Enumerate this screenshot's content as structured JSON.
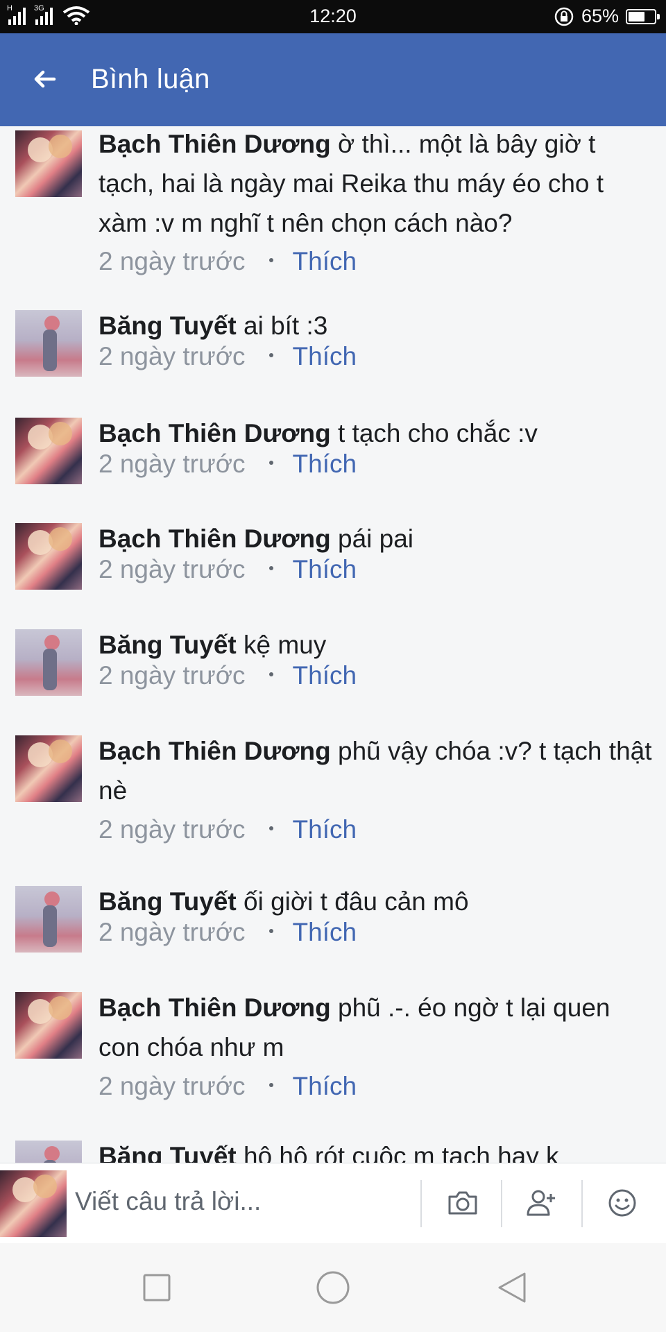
{
  "status_bar": {
    "network_type_left": "H",
    "network_type_right": "3G",
    "time": "12:20",
    "battery_level": "65%",
    "battery_fraction": 0.65
  },
  "header": {
    "back_icon": "arrow-left-icon",
    "title": "Bình luận"
  },
  "comments": [
    {
      "author": "Bạch Thiên Dương",
      "text": "ờ thì... một là bây giờ t tạch, hai là ngày mai Reika thu máy éo cho t xàm :v m nghĩ t nên chọn cách nào?",
      "time": "2 ngày trước",
      "like_label": "Thích",
      "avatar": "duong"
    },
    {
      "author": "Băng Tuyết",
      "text": "ai bít :3",
      "time": "2 ngày trước",
      "like_label": "Thích",
      "avatar": "tuyet"
    },
    {
      "author": "Bạch Thiên Dương",
      "text": "t tạch cho chắc :v",
      "time": "2 ngày trước",
      "like_label": "Thích",
      "avatar": "duong"
    },
    {
      "author": "Bạch Thiên Dương",
      "text": "pái pai",
      "time": "2 ngày trước",
      "like_label": "Thích",
      "avatar": "duong"
    },
    {
      "author": "Băng Tuyết",
      "text": "kệ muy",
      "time": "2 ngày trước",
      "like_label": "Thích",
      "avatar": "tuyet"
    },
    {
      "author": "Bạch Thiên Dương",
      "text": "phũ vậy chóa :v? t tạch thật nè",
      "time": "2 ngày trước",
      "like_label": "Thích",
      "avatar": "duong"
    },
    {
      "author": "Băng Tuyết",
      "text": "ối giời t đâu cản mô",
      "time": "2 ngày trước",
      "like_label": "Thích",
      "avatar": "tuyet"
    },
    {
      "author": "Bạch Thiên Dương",
      "text": "phũ .-. éo ngờ t lại quen con chóa như m",
      "time": "2 ngày trước",
      "like_label": "Thích",
      "avatar": "duong"
    },
    {
      "author": "Băng Tuyết",
      "text": "hô hô rót cuộc m tạch hay k",
      "time": "",
      "like_label": "",
      "avatar": "tuyet"
    }
  ],
  "reply_bar": {
    "placeholder": "Viết câu trả lời...",
    "icons": [
      "camera-icon",
      "add-friend-icon",
      "emoji-icon"
    ]
  },
  "nav_bar": {
    "icons": [
      "recent-apps-icon",
      "home-icon",
      "back-icon"
    ]
  },
  "colors": {
    "header_bg": "#4267b2",
    "like_link": "#4267b2",
    "meta_text": "#8d949e",
    "page_bg": "#f5f6f7"
  }
}
